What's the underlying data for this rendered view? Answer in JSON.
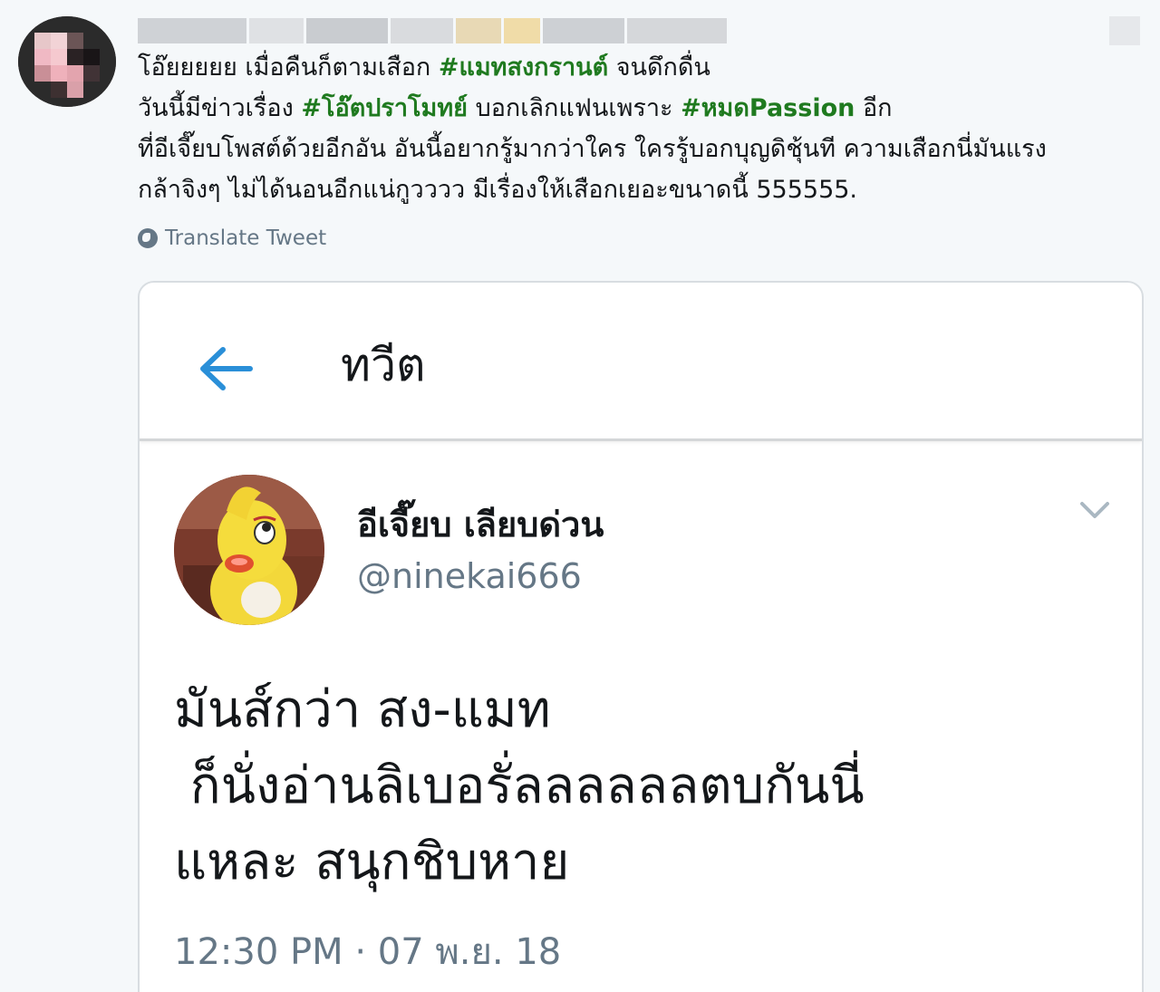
{
  "outer_tweet": {
    "text_lines": [
      [
        {
          "t": "โอ๊ยยยยย เมื่อคืนก็ตามเสือก ",
          "tag": false
        },
        {
          "t": "#แมทสงกรานต์",
          "tag": true
        },
        {
          "t": "  จนดึกดื่น",
          "tag": false
        }
      ],
      [
        {
          "t": "วันนี้มีข่าวเรื่อง ",
          "tag": false
        },
        {
          "t": "#โอ๊ตปราโมทย์",
          "tag": true
        },
        {
          "t": "  บอกเลิกแฟนเพราะ ",
          "tag": false
        },
        {
          "t": "#หมดPassion",
          "tag": true
        },
        {
          "t": "  อีก",
          "tag": false
        }
      ],
      [
        {
          "t": "ที่อีเจี๊ยบโพสต์ด้วยอีกอัน อันนี้อยากรู้มากว่าใคร ใครรู้บอกบุญดิชุ้นที ความเสือกนี่มันแรง",
          "tag": false
        }
      ],
      [
        {
          "t": "กล้าจิงๆ ไม่ได้นอนอีกแน่กูวววว มีเรื่องให้เสือกเยอะขนาดนี้ 555555.",
          "tag": false
        }
      ]
    ],
    "translate_label": "Translate Tweet",
    "colors": {
      "hashtag": "#1f7a1f",
      "text": "#14171a",
      "muted": "#657786",
      "background": "#f5f8fa"
    }
  },
  "embedded_card": {
    "header_title": "ทวีต",
    "back_icon": "arrow-left-icon",
    "author_name": "อีเจี๊ยบ เลียบด่วน",
    "author_handle": "@ninekai666",
    "dropdown_icon": "chevron-down-icon",
    "body_lines": [
      "มันส์กว่า สง-แมท",
      " ก็นั่งอ่านลิเบอรั่ลลลลลลตบกันนี่",
      "แหละ สนุกชิบหาย"
    ],
    "timestamp": "12:30 PM · 07 พ.ย. 18",
    "accent_color": "#2a8fd8"
  }
}
